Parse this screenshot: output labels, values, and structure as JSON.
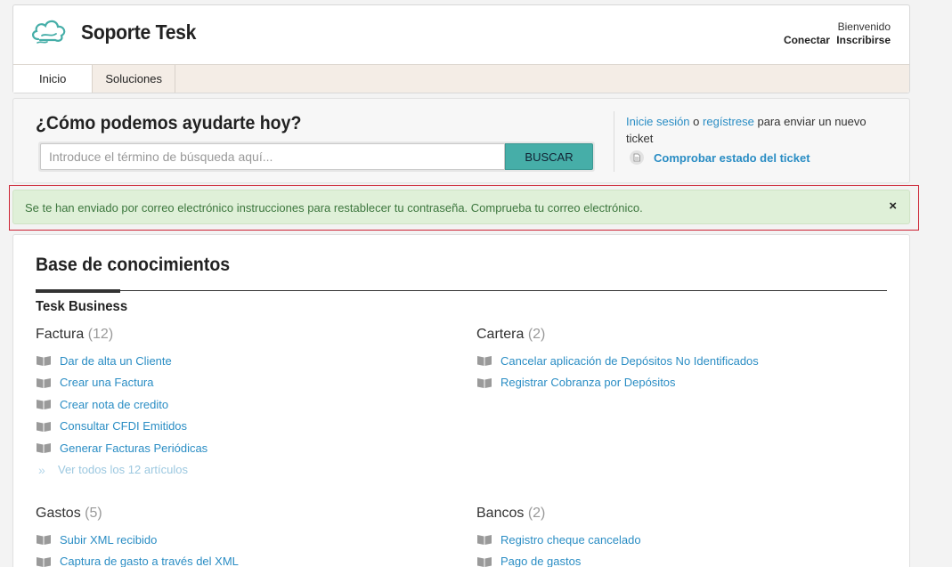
{
  "header": {
    "brand": "Soporte Tesk",
    "welcome": "Bienvenido",
    "login": "Conectar",
    "signup": "Inscribirse",
    "logo_icon": "cloud-icon"
  },
  "nav": {
    "tabs": [
      "Inicio",
      "Soluciones"
    ]
  },
  "search": {
    "title": "¿Cómo podemos ayudarte hoy?",
    "placeholder": "Introduce el término de búsqueda aquí...",
    "button": "BUSCAR"
  },
  "side": {
    "login_link": "Inicie sesión",
    "or": "o",
    "register_link": "regístrese",
    "tail": "para enviar un nuevo ticket",
    "check_status": "Comprobar estado del ticket"
  },
  "alert": {
    "message": "Se te han enviado por correo electrónico instrucciones para restablecer tu contraseña. Comprueba tu correo electrónico.",
    "close": "×"
  },
  "kb": {
    "title": "Base de conocimientos",
    "section": "Tesk Business",
    "categories": [
      {
        "name": "Factura",
        "count": "(12)",
        "articles": [
          "Dar de alta un Cliente",
          "Crear una Factura",
          "Crear nota de credito",
          "Consultar CFDI Emitidos",
          "Generar Facturas Periódicas"
        ],
        "more": "Ver todos los 12 artículos"
      },
      {
        "name": "Cartera",
        "count": "(2)",
        "articles": [
          "Cancelar aplicación de Depósitos No Identificados",
          "Registrar Cobranza por Depósitos"
        ]
      },
      {
        "name": "Gastos",
        "count": "(5)",
        "articles": [
          "Subir XML recibido",
          "Captura de gasto a través del XML"
        ]
      },
      {
        "name": "Bancos",
        "count": "(2)",
        "articles": [
          "Registro cheque cancelado",
          "Pago de gastos"
        ]
      }
    ]
  },
  "colors": {
    "accent": "#46aea8",
    "link": "#2a8dc4",
    "alert_bg": "#dff0d8",
    "alert_text": "#3c763d"
  }
}
